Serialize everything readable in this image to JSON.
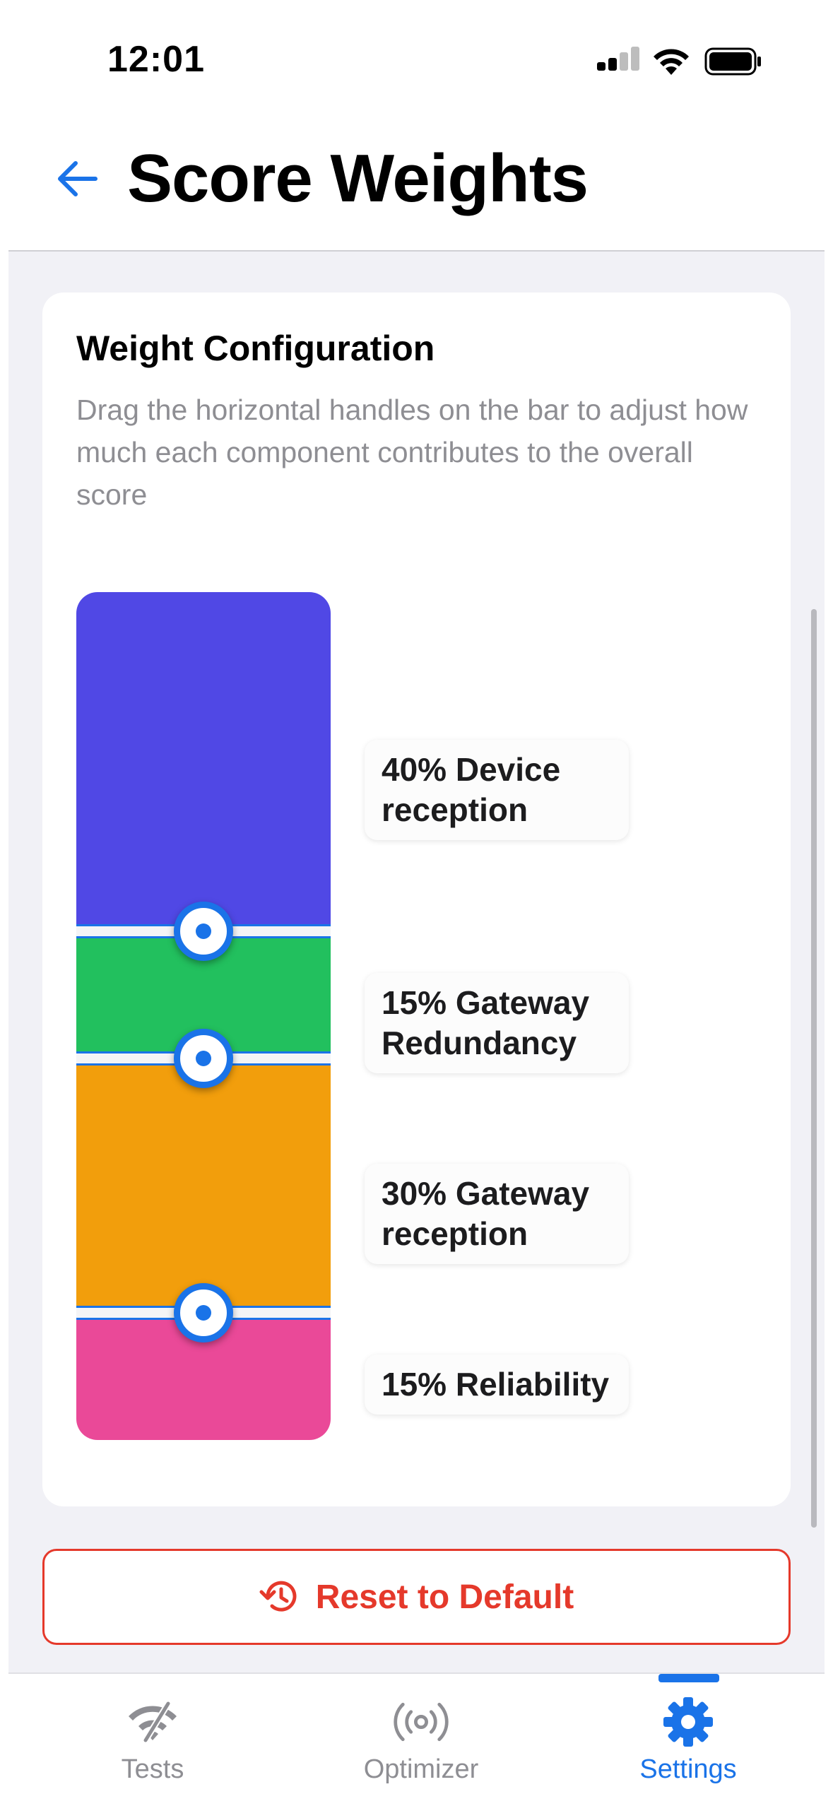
{
  "status_bar": {
    "time": "12:01"
  },
  "header": {
    "title": "Score Weights"
  },
  "card": {
    "title": "Weight Configuration",
    "description": "Drag the horizontal handles on the bar to adjust how much each component contributes to the overall score"
  },
  "weights": [
    {
      "label": "40% Device reception",
      "percent": 40,
      "color": "#5048e5"
    },
    {
      "label": "15% Gateway Redundancy",
      "percent": 15,
      "color": "#22c05e"
    },
    {
      "label": "30% Gateway reception",
      "percent": 30,
      "color": "#f29e0c"
    },
    {
      "label": "15% Reliability",
      "percent": 15,
      "color": "#ea4998"
    }
  ],
  "reset_button": {
    "label": "Reset to Default",
    "color": "#e5392b"
  },
  "tab_bar": {
    "tabs": [
      {
        "label": "Tests",
        "icon": "wifi-off-icon",
        "active": false
      },
      {
        "label": "Optimizer",
        "icon": "broadcast-icon",
        "active": false
      },
      {
        "label": "Settings",
        "icon": "gear-icon",
        "active": true
      }
    ]
  },
  "colors": {
    "accent": "#1a73e8",
    "destructive": "#e5392b"
  }
}
